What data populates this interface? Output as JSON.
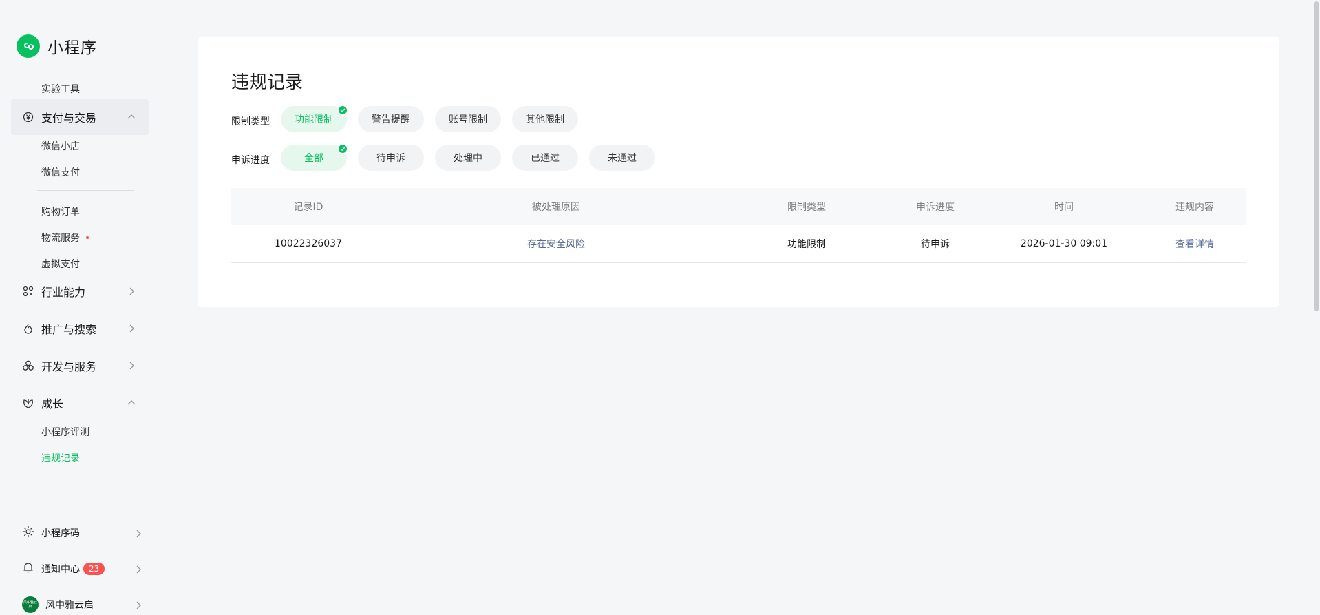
{
  "app": {
    "name": "小程序",
    "brand_color": "#07c160"
  },
  "sidebar": {
    "items": [
      {
        "label": "实验工具"
      },
      {
        "label": "支付与交易",
        "icon": "yen-circle-icon",
        "expanded": true
      },
      {
        "label": "微信小店"
      },
      {
        "label": "微信支付"
      },
      {
        "label": "购物订单"
      },
      {
        "label": "物流服务",
        "dot": true
      },
      {
        "label": "虚拟支付"
      },
      {
        "label": "行业能力",
        "icon": "industry-icon"
      },
      {
        "label": "推广与搜索",
        "icon": "flame-icon"
      },
      {
        "label": "开发与服务",
        "icon": "cluster-icon"
      },
      {
        "label": "成长",
        "icon": "growth-icon",
        "expanded": true
      },
      {
        "label": "小程序评测"
      },
      {
        "label": "违规记录",
        "active": true
      }
    ],
    "bottom": [
      {
        "label": "小程序码",
        "icon": "qrcode-sun-icon"
      },
      {
        "label": "通知中心",
        "icon": "bell-icon",
        "badge": "23"
      },
      {
        "label": "风中雅云启",
        "icon": "avatar"
      }
    ],
    "avatar_text": "风中雅云启"
  },
  "main": {
    "title": "违规记录",
    "filters": [
      {
        "label": "限制类型",
        "options": [
          "功能限制",
          "警告提醒",
          "账号限制",
          "其他限制"
        ],
        "selected": "功能限制"
      },
      {
        "label": "申诉进度",
        "options": [
          "全部",
          "待申诉",
          "处理中",
          "已通过",
          "未通过"
        ],
        "selected": "全部"
      }
    ],
    "table": {
      "columns": [
        "记录ID",
        "被处理原因",
        "限制类型",
        "申诉进度",
        "时间",
        "违规内容"
      ],
      "rows": [
        {
          "id": "10022326037",
          "reason": "存在安全风险",
          "type": "功能限制",
          "status": "待申诉",
          "time": "2026-01-30 09:01",
          "action": "查看详情"
        }
      ]
    }
  }
}
